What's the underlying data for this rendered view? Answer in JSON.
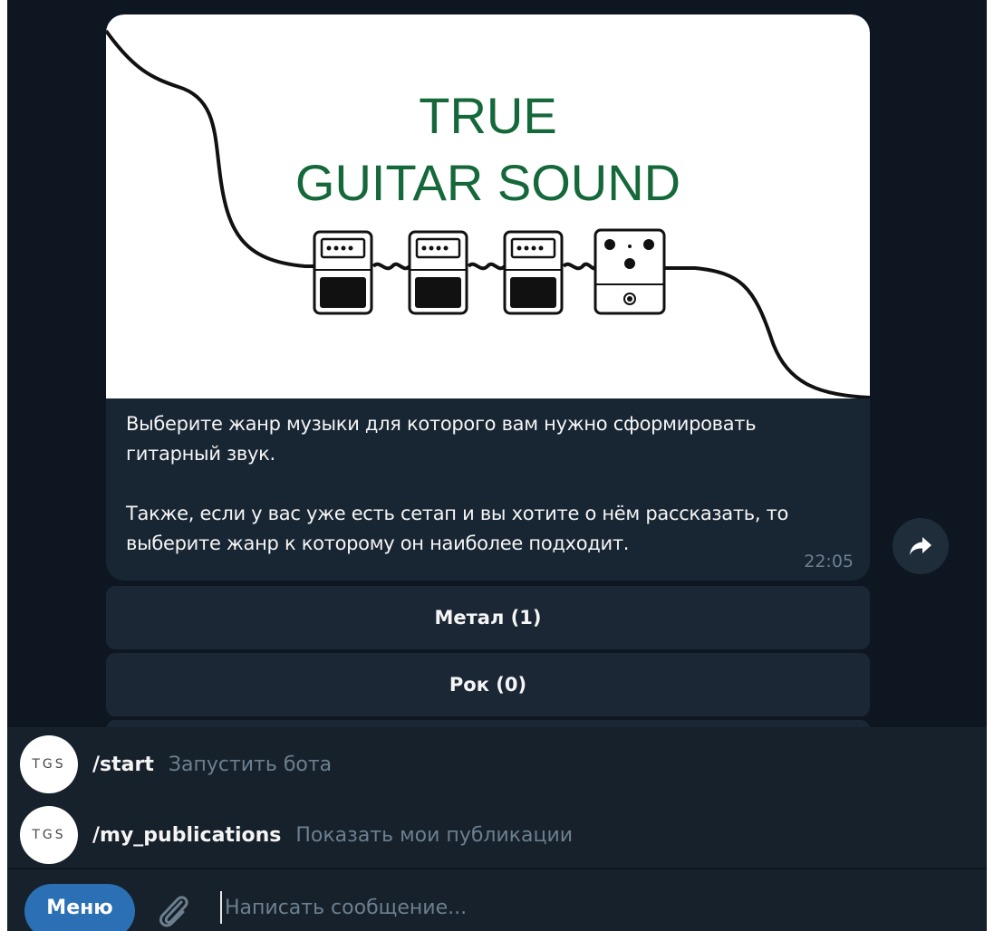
{
  "message": {
    "image": {
      "logo_line1": "TRUE",
      "logo_line2": "GUITAR SOUND",
      "icon": "guitar-pedals-illustration"
    },
    "caption_paragraph1": "Выберите жанр музыки для которого вам нужно сформировать гитарный звук.",
    "caption_paragraph2": "Также, если у вас уже есть сетап и вы хотите о нём рассказать, то выберите жанр к которому он наиболее подходит.",
    "time": "22:05",
    "forward_icon": "forward-arrow-icon"
  },
  "keyboard": {
    "buttons": [
      {
        "label": "Метал (1)"
      },
      {
        "label": "Рок (0)"
      }
    ]
  },
  "commands": [
    {
      "avatar": "TGS",
      "name": "/start",
      "description": "Запустить бота"
    },
    {
      "avatar": "TGS",
      "name": "/my_publications",
      "description": "Показать мои публикации"
    }
  ],
  "composer": {
    "menu_label": "Меню",
    "attach_icon": "paperclip-icon",
    "placeholder": "Написать сообщение..."
  },
  "colors": {
    "background": "#0e1621",
    "bubble": "#182533",
    "logo_green": "#14683a",
    "menu_button": "#2b6fb4"
  }
}
